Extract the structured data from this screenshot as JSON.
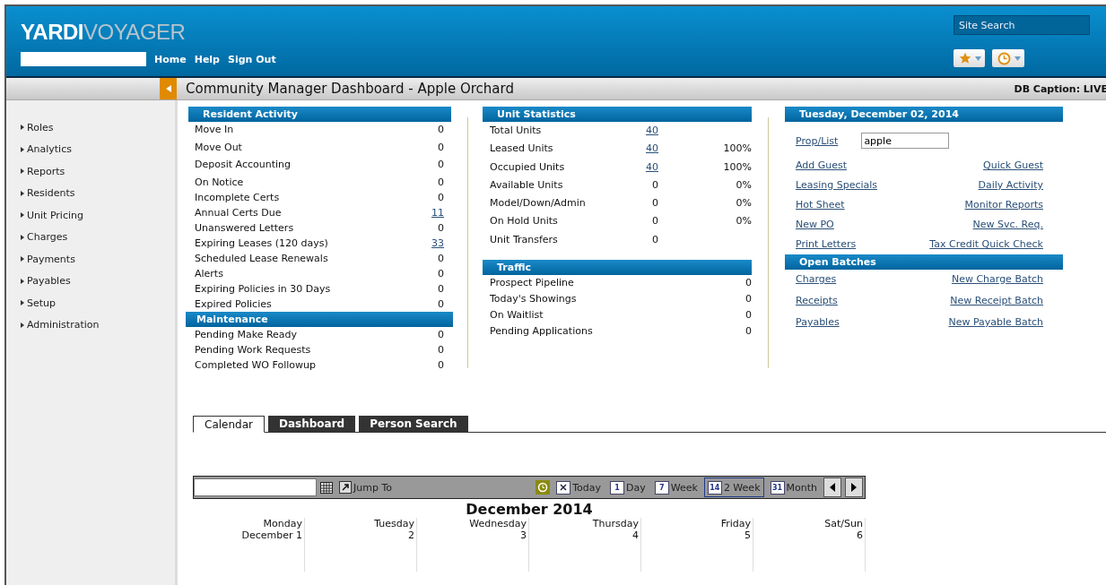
{
  "header": {
    "logo_first": "YARDI",
    "logo_second": "VOYAGER",
    "nav": [
      "Home",
      "Help",
      "Sign Out"
    ],
    "site_search": {
      "placeholder": "Site Search"
    }
  },
  "title": "Community Manager Dashboard - Apple Orchard",
  "db_caption": "DB Caption: LIVE",
  "sidebar": {
    "items": [
      "Roles",
      "Analytics",
      "Reports",
      "Residents",
      "Unit Pricing",
      "Charges",
      "Payments",
      "Payables",
      "Setup",
      "Administration"
    ]
  },
  "resident_activity": {
    "title": "Resident Activity",
    "rows": [
      {
        "label": "Move In",
        "value": "0",
        "linked": false
      },
      {
        "label": "Move Out",
        "value": "0",
        "linked": false
      },
      {
        "label": "Deposit Accounting",
        "value": "0",
        "linked": false
      },
      {
        "label": "On Notice",
        "value": "0",
        "linked": false
      },
      {
        "label": "Incomplete Certs",
        "value": "0",
        "linked": false
      },
      {
        "label": "Annual Certs Due",
        "value": "11",
        "linked": true
      },
      {
        "label": "Unanswered Letters",
        "value": "0",
        "linked": false
      },
      {
        "label": "Expiring Leases (120 days)",
        "value": "33",
        "linked": true
      },
      {
        "label": "Scheduled Lease Renewals",
        "value": "0",
        "linked": false
      },
      {
        "label": "Alerts",
        "value": "0",
        "linked": false
      },
      {
        "label": "Expiring Policies in 30 Days",
        "value": "0",
        "linked": false
      },
      {
        "label": "Expired Policies",
        "value": "0",
        "linked": false
      }
    ]
  },
  "maintenance": {
    "title": "Maintenance",
    "rows": [
      {
        "label": "Pending Make Ready",
        "value": "0"
      },
      {
        "label": "Pending Work Requests",
        "value": "0"
      },
      {
        "label": "Completed WO Followup",
        "value": "0"
      }
    ]
  },
  "unit_statistics": {
    "title": "Unit Statistics",
    "rows": [
      {
        "label": "Total Units",
        "count": "40",
        "linked": true
      },
      {
        "label": "Leased Units",
        "count": "40",
        "linked": true,
        "percent": "100%"
      },
      {
        "label": "Occupied Units",
        "count": "40",
        "linked": true,
        "percent": "100%"
      },
      {
        "label": "Available Units",
        "count": "0",
        "linked": false,
        "percent": "0%"
      },
      {
        "label": "Model/Down/Admin",
        "count": "0",
        "linked": false,
        "percent": "0%"
      },
      {
        "label": "On Hold Units",
        "count": "0",
        "linked": false,
        "percent": "0%"
      },
      {
        "label": "Unit Transfers",
        "count": "0",
        "linked": false
      }
    ]
  },
  "traffic": {
    "title": "Traffic",
    "rows": [
      {
        "label": "Prospect Pipeline",
        "value": "0"
      },
      {
        "label": "Today's Showings",
        "value": "0"
      },
      {
        "label": "On Waitlist",
        "value": "0"
      },
      {
        "label": "Pending Applications",
        "value": "0"
      }
    ]
  },
  "date_panel": {
    "title": "Tuesday, December 02, 2014",
    "prop_label": "Prop/List",
    "prop_value": "apple",
    "links": [
      {
        "left": "Add Guest",
        "right": "Quick Guest"
      },
      {
        "left": "Leasing Specials",
        "right": "Daily Activity"
      },
      {
        "left": "Hot Sheet",
        "right": "Monitor Reports"
      },
      {
        "left": "New PO",
        "right": "New Svc. Req."
      },
      {
        "left": "Print Letters",
        "right": "Tax Credit Quick Check"
      }
    ]
  },
  "open_batches": {
    "title": "Open Batches",
    "rows": [
      {
        "left": "Charges",
        "right": "New Charge Batch"
      },
      {
        "left": "Receipts",
        "right": "New Receipt Batch"
      },
      {
        "left": "Payables",
        "right": "New Payable Batch"
      }
    ]
  },
  "tabs": [
    {
      "label": "Calendar",
      "selected": true
    },
    {
      "label": "Dashboard",
      "selected": false
    },
    {
      "label": "Person Search",
      "selected": false
    }
  ],
  "calendar": {
    "jump_label": "Jump To",
    "views": [
      {
        "label": "Today",
        "selected": false
      },
      {
        "label": "Day",
        "badge": "1",
        "selected": false
      },
      {
        "label": "Week",
        "badge": "7",
        "selected": false
      },
      {
        "label": "2 Week",
        "badge": "14",
        "selected": true
      },
      {
        "label": "Month",
        "badge": "31",
        "selected": false
      }
    ],
    "month_title": "December 2014",
    "days": [
      {
        "name": "Monday",
        "date": "December 1"
      },
      {
        "name": "Tuesday",
        "date": "2"
      },
      {
        "name": "Wednesday",
        "date": "3"
      },
      {
        "name": "Thursday",
        "date": "4"
      },
      {
        "name": "Friday",
        "date": "5"
      },
      {
        "name": "Sat/Sun",
        "date": "6"
      }
    ]
  }
}
